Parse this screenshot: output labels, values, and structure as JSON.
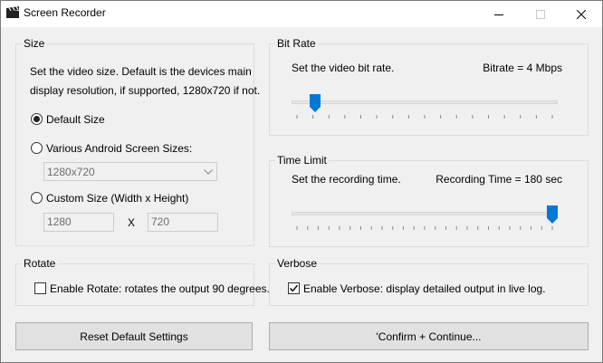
{
  "window": {
    "title": "Screen Recorder",
    "icon": "clapperboard-icon"
  },
  "size_group": {
    "title": "Size",
    "description_line1": "Set the video size. Default is the devices main",
    "description_line2": "display resolution, if supported, 1280x720 if not.",
    "option_default": "Default Size",
    "option_various": "Various Android Screen Sizes:",
    "various_selected": "1280x720",
    "option_custom": "Custom Size (Width x Height)",
    "width_value": "1280",
    "separator": "X",
    "height_value": "720",
    "selected_option": "default"
  },
  "bitrate_group": {
    "title": "Bit Rate",
    "description": "Set the video bit rate.",
    "value_label": "Bitrate = 4 Mbps",
    "slider_fraction": 0.07
  },
  "timelimit_group": {
    "title": "Time Limit",
    "description": "Set the recording time.",
    "value_label": "Recording Time = 180 sec",
    "slider_fraction": 1.0
  },
  "rotate_group": {
    "title": "Rotate",
    "checkbox_label": "Enable Rotate: rotates the output 90 degrees.",
    "checked": false
  },
  "verbose_group": {
    "title": "Verbose",
    "checkbox_label": "Enable Verbose: display detailed output in live log.",
    "checked": true
  },
  "buttons": {
    "reset": "Reset Default Settings",
    "confirm": "'Confirm + Continue..."
  },
  "colors": {
    "slider_thumb": "#0078d7",
    "border_group": "#dcdcdc",
    "button_face": "#e1e1e1"
  }
}
